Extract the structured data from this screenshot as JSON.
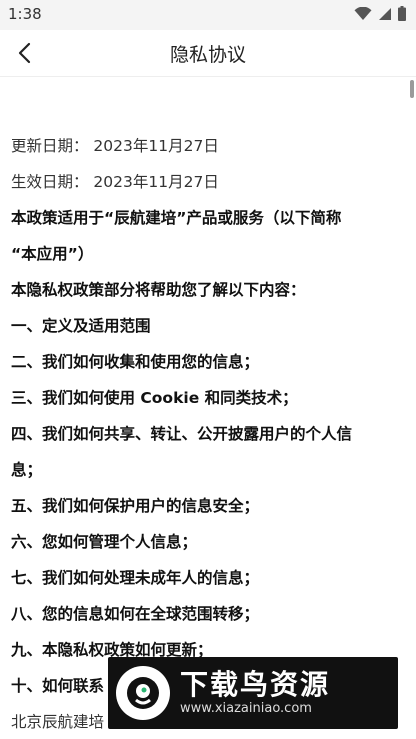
{
  "status_bar": {
    "time": "1:38"
  },
  "header": {
    "title": "隐私协议"
  },
  "content": {
    "lines": [
      {
        "text": "更新日期：   2023年11月27日",
        "bold": false
      },
      {
        "text": "生效日期：   2023年11月27日",
        "bold": false
      },
      {
        "text": "本政策适用于“辰航建培”产品或服务（以下简称",
        "bold": true
      },
      {
        "text": "“本应用”）",
        "bold": true
      },
      {
        "text": "本隐私权政策部分将帮助您了解以下内容：",
        "bold": true
      },
      {
        "text": "一、定义及适用范围",
        "bold": true
      },
      {
        "text": "二、我们如何收集和使用您的信息；",
        "bold": true
      },
      {
        "text": "三、我们如何使用 Cookie 和同类技术；",
        "bold": true
      },
      {
        "text": "四、我们如何共享、转让、公开披露用户的个人信",
        "bold": true
      },
      {
        "text": "息；",
        "bold": true
      },
      {
        "text": "五、我们如何保护用户的信息安全；",
        "bold": true
      },
      {
        "text": "六、您如何管理个人信息；",
        "bold": true
      },
      {
        "text": "七、我们如何处理未成年人的信息；",
        "bold": true
      },
      {
        "text": "八、您的信息如何在全球范围转移；",
        "bold": true
      },
      {
        "text": "九、本隐私权政策如何更新；",
        "bold": true
      },
      {
        "text": "十、如何联系",
        "bold": true
      },
      {
        "text": "北京辰航建培",
        "bold": false
      }
    ]
  },
  "watermark": {
    "title": "下载鸟资源",
    "url": "www.xiazainiao.com"
  }
}
